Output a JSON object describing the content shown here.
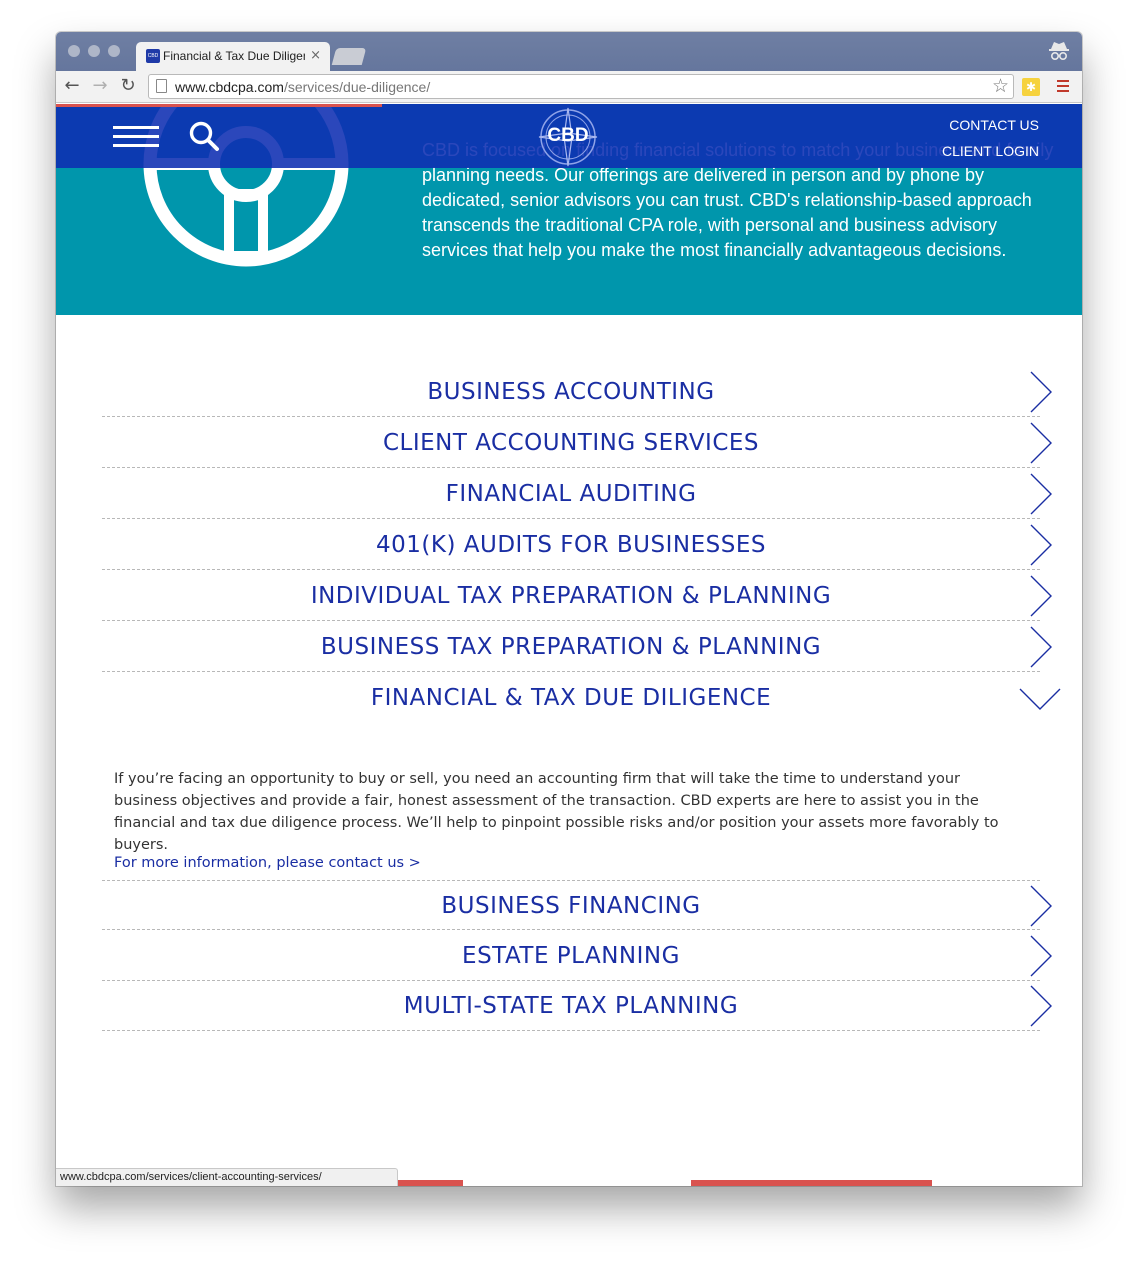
{
  "browser": {
    "tab_title": "Financial & Tax Due Diligen",
    "tab_favicon_text": "CBD",
    "tab_close": "×",
    "url_host": "www.cbdcpa.com",
    "url_path": "/services/due-diligence/",
    "status_url": "www.cbdcpa.com/services/client-accounting-services/"
  },
  "site": {
    "logo_text": "CBD",
    "nav": {
      "contact": "CONTACT US",
      "login": "CLIENT LOGIN"
    },
    "hero_text": "CBD is focused on finding financial solutions to match your business and family planning needs. Our offerings are delivered in person and by phone by dedicated, senior advisors you can trust. CBD's relationship-based approach transcends the traditional CPA role, with personal and business advisory services that help you make the most financially advantageous decisions."
  },
  "services": [
    {
      "label": "BUSINESS ACCOUNTING",
      "expanded": false
    },
    {
      "label": "CLIENT ACCOUNTING SERVICES",
      "expanded": false
    },
    {
      "label": "FINANCIAL AUDITING",
      "expanded": false
    },
    {
      "label": "401(K) AUDITS FOR BUSINESSES",
      "expanded": false
    },
    {
      "label": "INDIVIDUAL TAX PREPARATION & PLANNING",
      "expanded": false
    },
    {
      "label": "BUSINESS TAX PREPARATION & PLANNING",
      "expanded": false
    },
    {
      "label": "FINANCIAL & TAX DUE DILIGENCE",
      "expanded": true
    },
    {
      "label": "BUSINESS FINANCING",
      "expanded": false
    },
    {
      "label": "ESTATE PLANNING",
      "expanded": false
    },
    {
      "label": "MULTI-STATE TAX PLANNING",
      "expanded": false
    }
  ],
  "expanded_detail": {
    "body": "If you’re facing an opportunity to buy or sell, you need an accounting firm that will take the time to understand your business objectives and provide a fair, honest assessment of the transaction. CBD experts are here to assist you in the financial and tax due diligence process. We’ll help to pinpoint possible risks and/or position your assets more favorably to buyers.",
    "link": "For more information, please contact us >"
  },
  "colors": {
    "brand_blue": "#1a2ea3",
    "nav_blue": "#0e2db2",
    "teal": "#0096ac",
    "accent_red": "#d9534f"
  }
}
